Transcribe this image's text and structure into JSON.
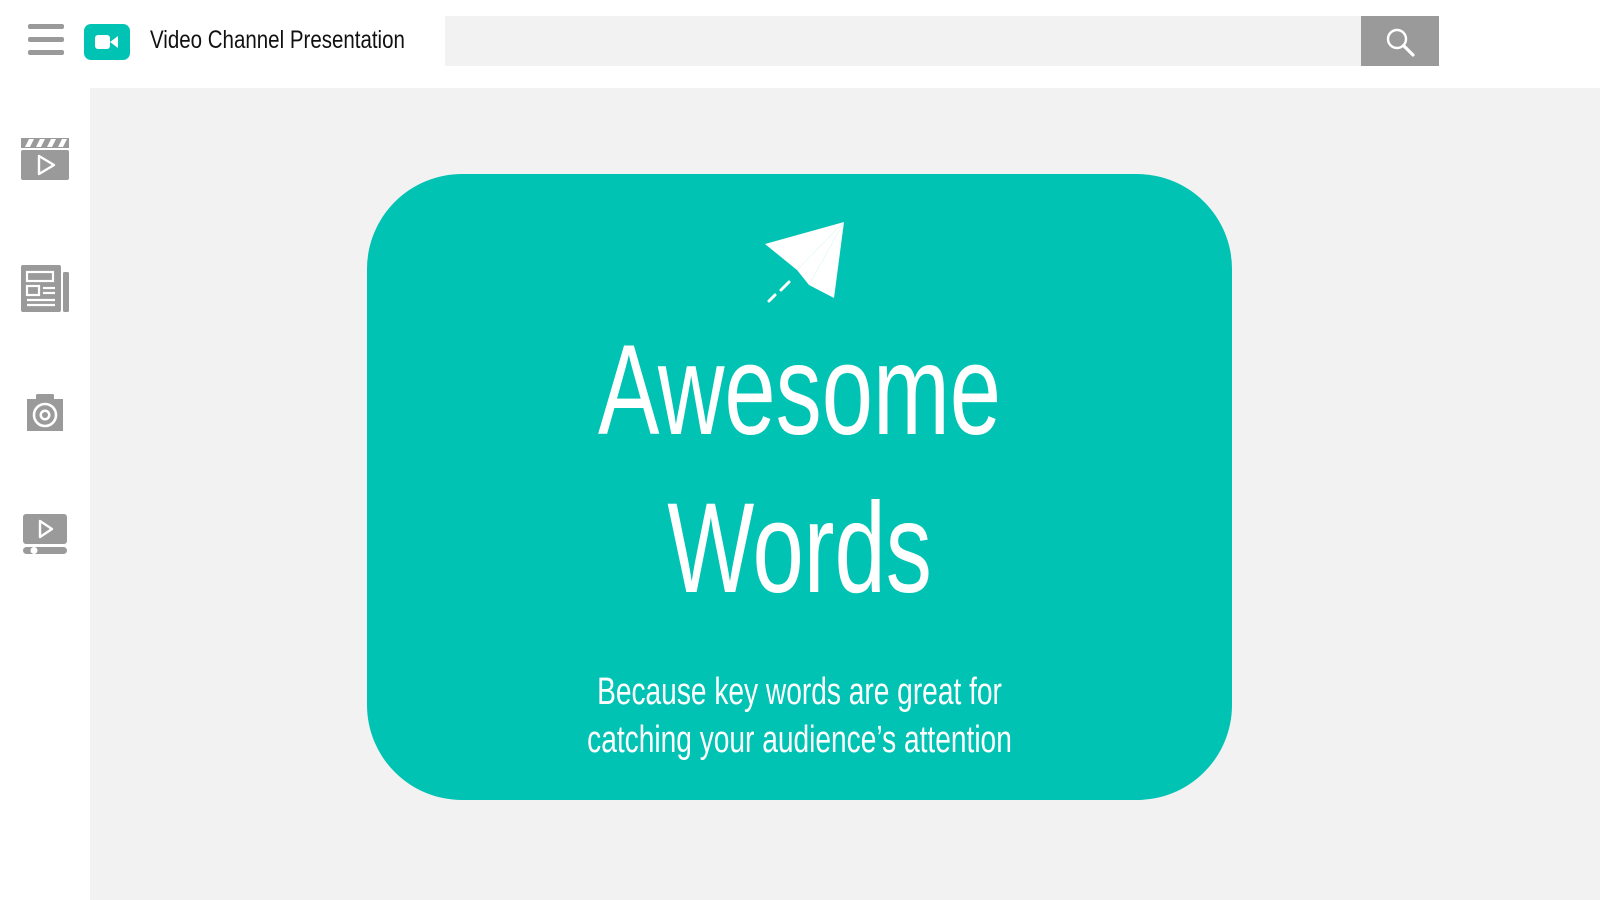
{
  "header": {
    "menu_icon": "hamburger-menu-icon",
    "logo_icon": "video-camera-icon",
    "title": "Video Channel Presentation",
    "search": {
      "value": "",
      "placeholder": "",
      "button_icon": "search-icon"
    }
  },
  "sidebar": {
    "items": [
      {
        "icon": "video-clapper-icon"
      },
      {
        "icon": "newspaper-icon"
      },
      {
        "icon": "camera-icon"
      },
      {
        "icon": "video-player-icon"
      }
    ]
  },
  "slide": {
    "icon": "paper-plane-icon",
    "headline_line1": "Awesome",
    "headline_line2": "Words",
    "subtitle_line1": "Because key words are great for",
    "subtitle_line2": "catching your audience’s attention"
  },
  "colors": {
    "accent": "#01c3b3",
    "icon_gray": "#9a9a9a",
    "content_background": "#f2f2f2",
    "text_dark": "#111111",
    "text_light": "#ffffff"
  }
}
